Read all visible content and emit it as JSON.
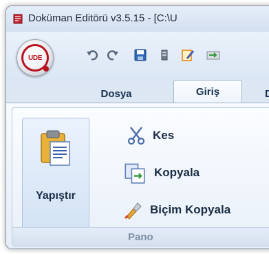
{
  "window": {
    "title": "Doküman Editörü v3.5.15 - [C:\\U"
  },
  "app_button": {
    "logo_text": "UDE",
    "icon": "app-orb-icon"
  },
  "quick_access": [
    {
      "icon": "undo-icon"
    },
    {
      "icon": "redo-icon"
    },
    {
      "icon": "save-icon"
    },
    {
      "icon": "print-icon"
    },
    {
      "icon": "edit-icon"
    },
    {
      "icon": "export-icon"
    }
  ],
  "tabs": [
    {
      "label": "Dosya"
    },
    {
      "label": "Giriş",
      "selected": true
    },
    {
      "label": "D"
    }
  ],
  "ribbon": {
    "group_label": "Pano",
    "paste_label": "Yapıştır",
    "commands": {
      "cut": "Kes",
      "copy": "Kopyala",
      "format_painter": "Biçim Kopyala"
    }
  },
  "colors": {
    "brand_red": "#b8121f",
    "tab_text": "#15304f",
    "group_label_text": "#7d8ea3"
  }
}
